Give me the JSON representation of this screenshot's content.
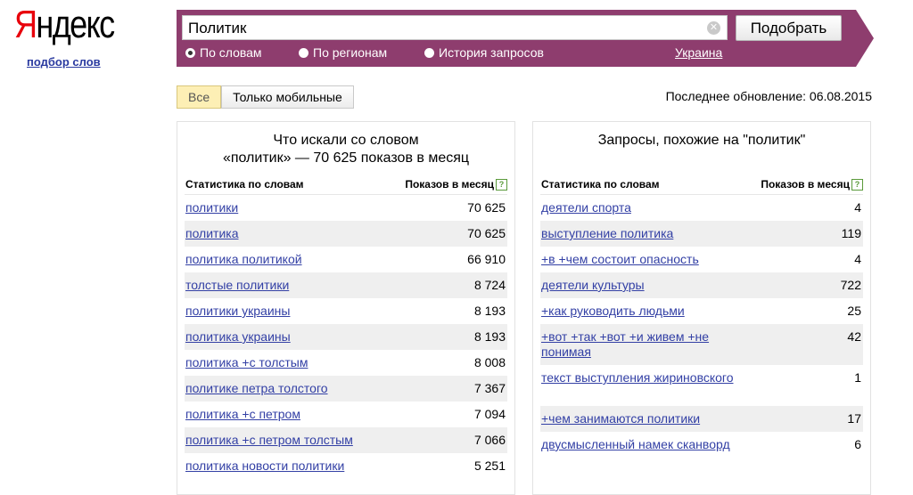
{
  "logo": {
    "first_letter": "Я",
    "rest": "ндекс",
    "subtitle": "подбор слов"
  },
  "search": {
    "value": "Политик",
    "button_label": "Подобрать"
  },
  "radios": [
    {
      "label": "По словам",
      "selected": true
    },
    {
      "label": "По регионам",
      "selected": false
    },
    {
      "label": "История запросов",
      "selected": false
    }
  ],
  "region_link": "Украина",
  "tabs": [
    {
      "label": "Все"
    },
    {
      "label": "Только мобильные"
    }
  ],
  "last_update": "Последнее обновление: 06.08.2015",
  "left_panel": {
    "title_line1": "Что искали со словом",
    "title_line2": "«политик» — 70 625 показов в месяц",
    "col_phrase": "Статистика по словам",
    "col_count": "Показов в месяц",
    "rows": [
      {
        "phrase": "политики",
        "count": "70 625"
      },
      {
        "phrase": "политика",
        "count": "70 625"
      },
      {
        "phrase": "политика политикой",
        "count": "66 910"
      },
      {
        "phrase": "толстые политики",
        "count": "8 724"
      },
      {
        "phrase": "политики украины",
        "count": "8 193"
      },
      {
        "phrase": "политика украины",
        "count": "8 193"
      },
      {
        "phrase": "политика +с толстым",
        "count": "8 008"
      },
      {
        "phrase": "политике петра толстого",
        "count": "7 367"
      },
      {
        "phrase": "политика +с петром",
        "count": "7 094"
      },
      {
        "phrase": "политика +с петром толстым",
        "count": "7 066"
      },
      {
        "phrase": "политика новости политики",
        "count": "5 251"
      }
    ]
  },
  "right_panel": {
    "title_line1": "Запросы, похожие на \"политик\"",
    "col_phrase": "Статистика по словам",
    "col_count": "Показов в месяц",
    "rows": [
      {
        "phrase": "деятели спорта",
        "count": "4"
      },
      {
        "phrase": "выступление политика",
        "count": "119"
      },
      {
        "phrase": "+в +чем состоит опасность",
        "count": "4"
      },
      {
        "phrase": "деятели культуры",
        "count": "722"
      },
      {
        "phrase": "+как руководить людьми",
        "count": "25"
      },
      {
        "phrase": "+вот +так +вот +и живем +не понимая",
        "count": "42"
      },
      {
        "phrase": "текст выступления жириновского",
        "count": "1"
      },
      {
        "phrase": "+чем занимаются политики",
        "count": "17"
      },
      {
        "phrase": "двусмысленный намек сканворд",
        "count": "6"
      }
    ]
  }
}
